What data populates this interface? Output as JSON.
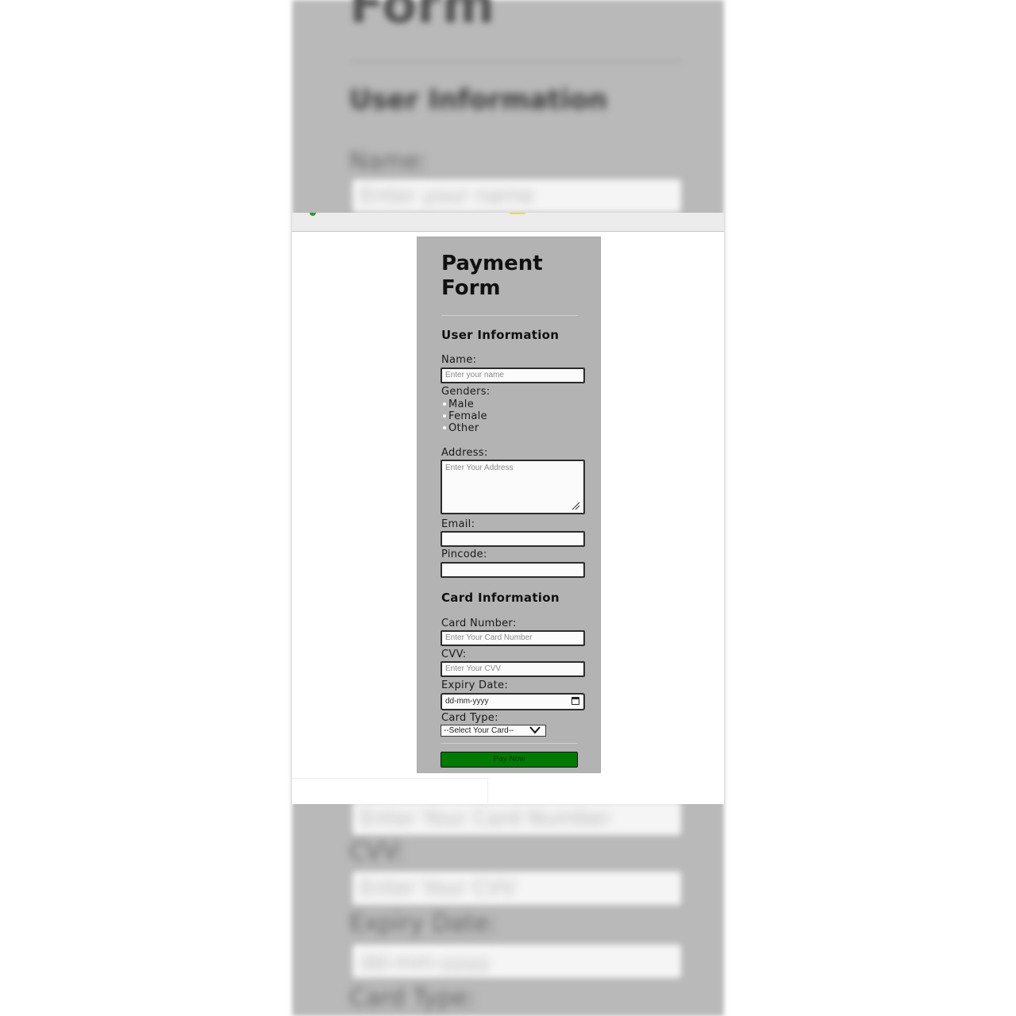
{
  "form": {
    "title": "Payment Form",
    "user_section": {
      "heading": "User Information",
      "name_label": "Name:",
      "name_placeholder": "Enter your name",
      "genders_label": "Genders:",
      "gender_options": [
        "Male",
        "Female",
        "Other"
      ],
      "address_label": "Address:",
      "address_placeholder": "Enter Your Address",
      "email_label": "Email:",
      "pincode_label": "Pincode:"
    },
    "card_section": {
      "heading": "Card Information",
      "card_number_label": "Card Number:",
      "card_number_placeholder": "Enter Your Card Number",
      "cvv_label": "CVV:",
      "cvv_placeholder": "Enter Your CVV",
      "expiry_label": "Expiry Date:",
      "expiry_placeholder": "dd-mm-yyyy",
      "card_type_label": "Card Type:",
      "card_type_selected": "--Select Your Card--"
    },
    "submit_label": "Pay Now"
  },
  "colors": {
    "card_background": "#b3b3b3",
    "button_green": "#007a00",
    "page_background": "#ffffff"
  }
}
